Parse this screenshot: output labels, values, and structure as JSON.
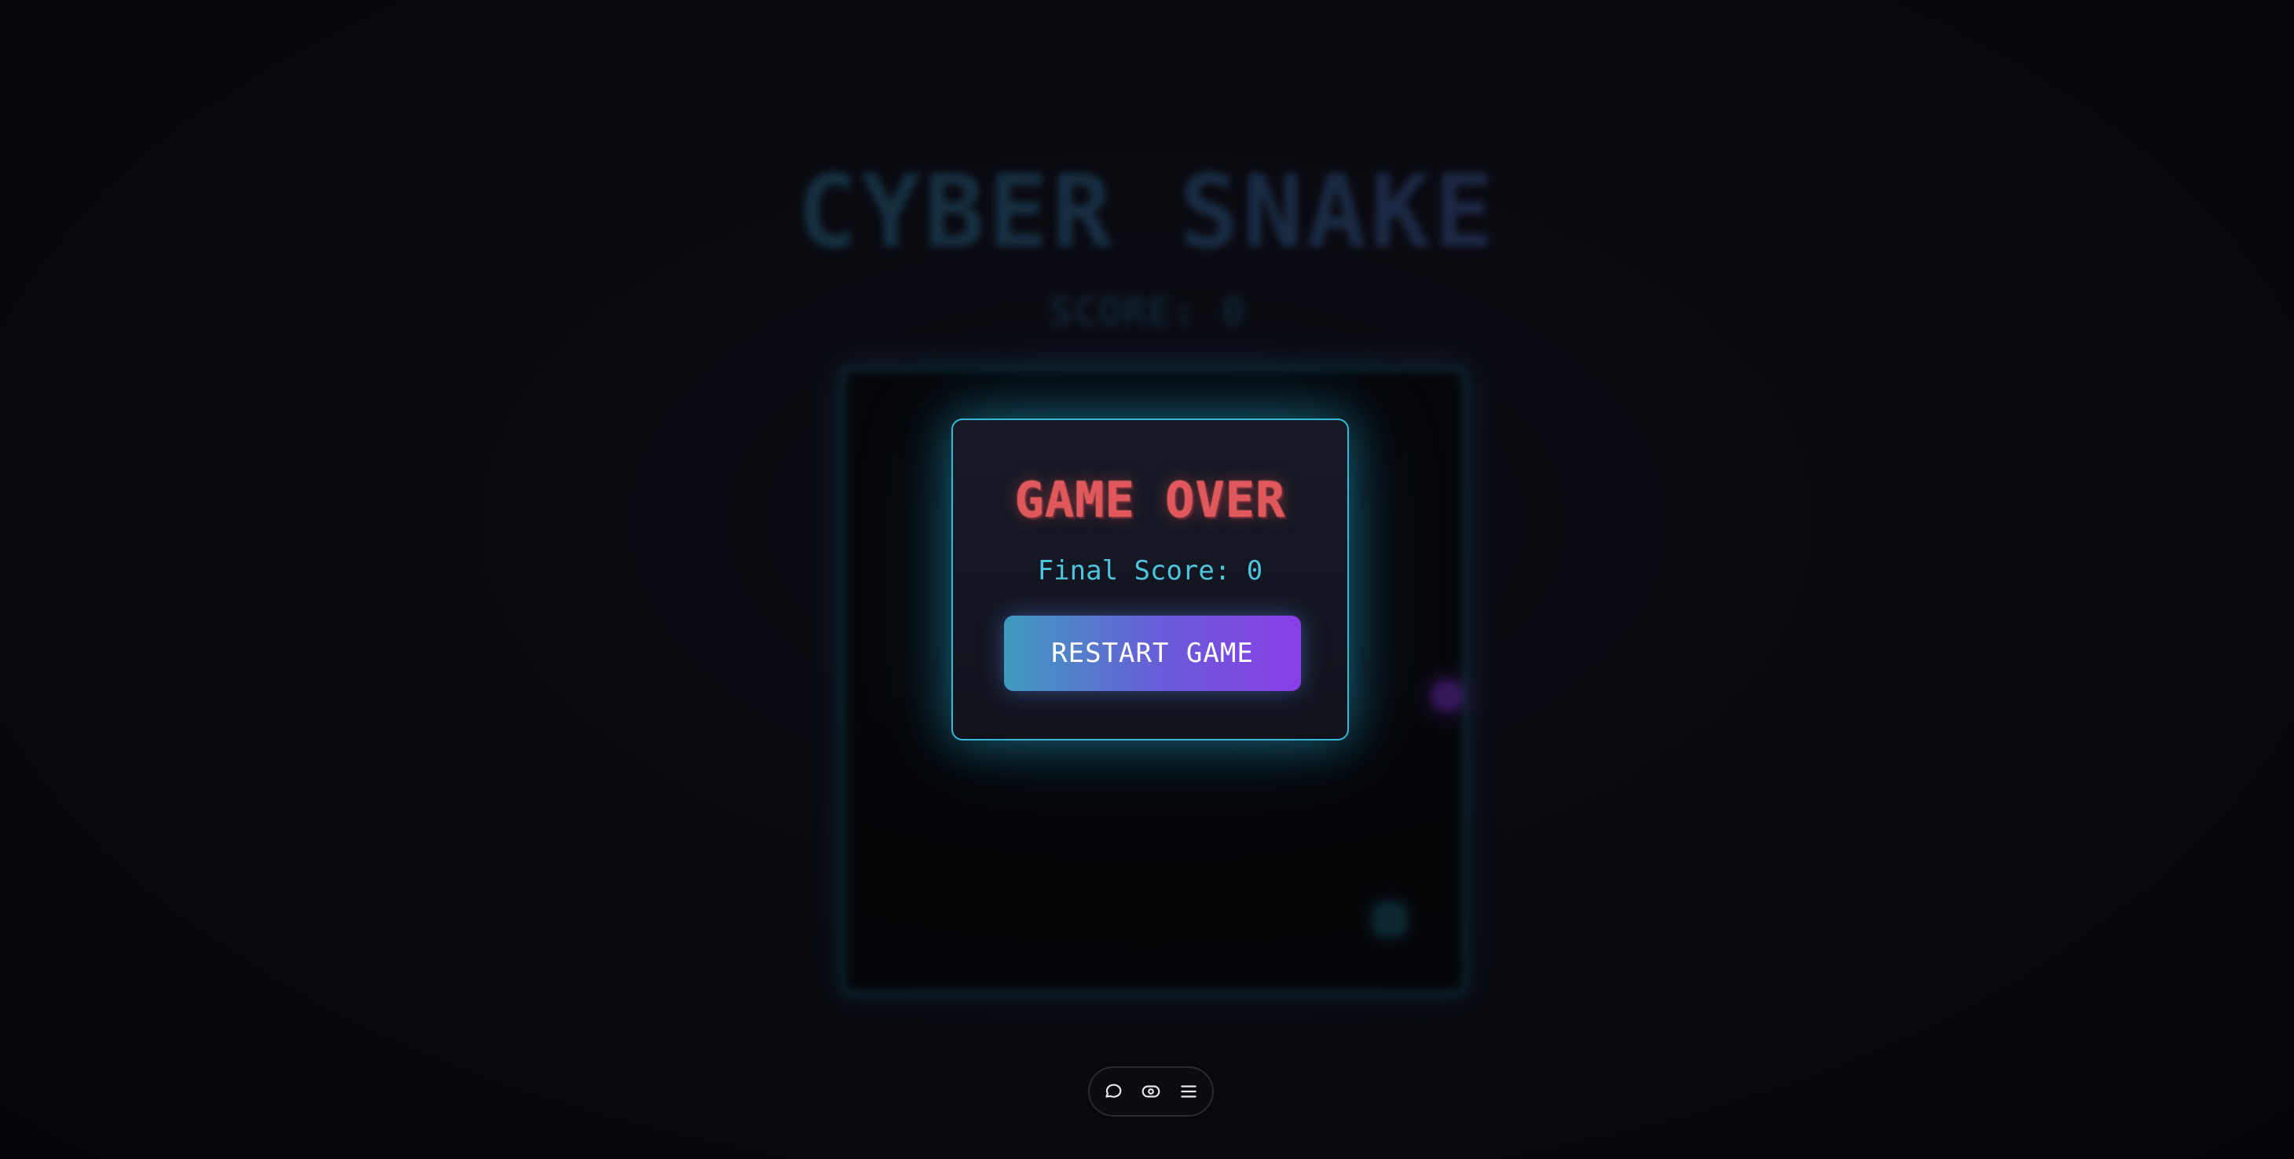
{
  "game": {
    "title": "CYBER SNAKE",
    "score_text": "SCORE: 0"
  },
  "modal": {
    "title": "GAME OVER",
    "final_score": "Final Score: 0",
    "restart_label": "RESTART GAME"
  },
  "toolbar": {
    "icons": [
      "chat-icon",
      "eye-icon",
      "menu-icon"
    ]
  },
  "colors": {
    "accent_cyan": "#37b8d6",
    "accent_purple": "#8a3fe6",
    "game_over_red": "#e0585e",
    "background": "#07070c"
  }
}
